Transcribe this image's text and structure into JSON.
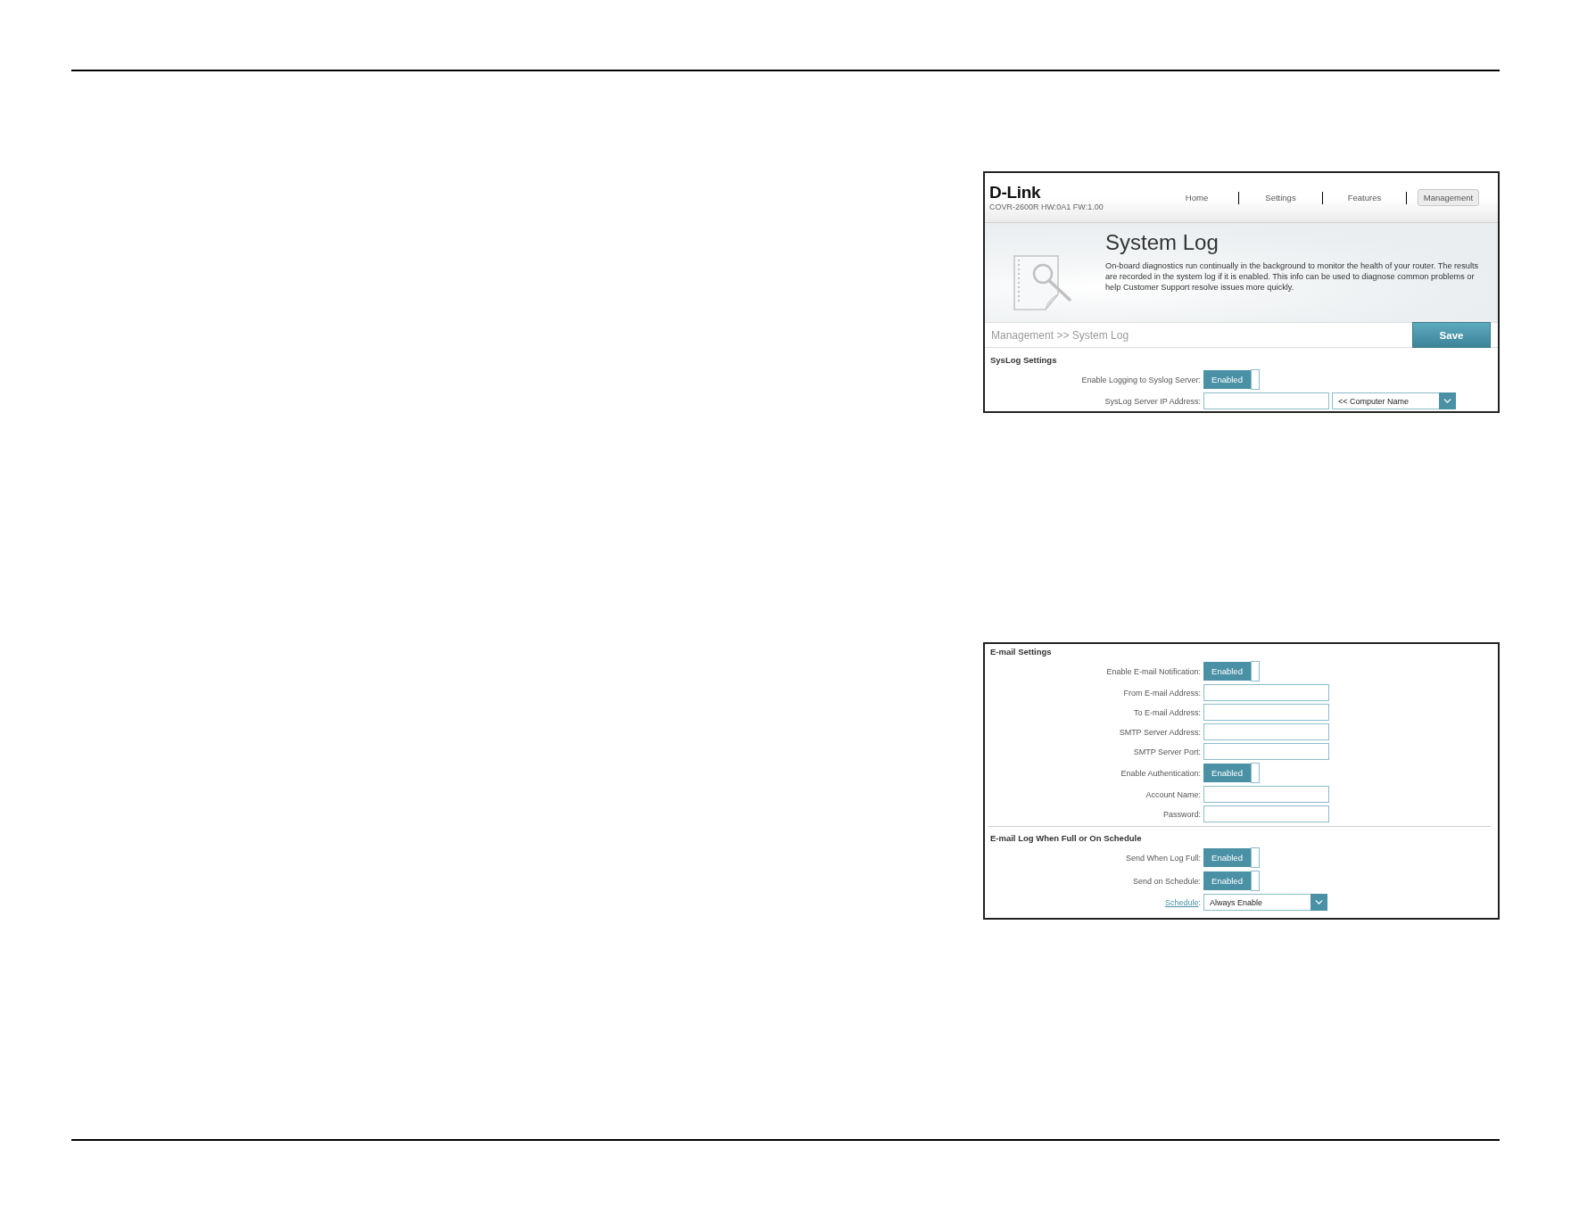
{
  "syslog_screen": {
    "header": {
      "logo": "D-Link",
      "model": "COVR-2600R HW:0A1 FW:1.00",
      "nav": [
        {
          "label": "Home",
          "selected": false
        },
        {
          "label": "Settings",
          "selected": false
        },
        {
          "label": "Features",
          "selected": false
        },
        {
          "label": "Management",
          "selected": true
        }
      ]
    },
    "banner": {
      "title": "System Log",
      "description": "On-board diagnostics run continually in the background to monitor the health of your router. The results are recorded in the system log if it is enabled. This info can be used to diagnose common problems or help Customer Support resolve issues more quickly."
    },
    "breadcrumb": "Management >> System Log",
    "save_button": "Save",
    "sections": [
      {
        "title": "SysLog Settings",
        "rows": [
          {
            "kind": "toggle",
            "label": "Enable Logging to Syslog Server:",
            "on": true,
            "text": "Enabled"
          },
          {
            "kind": "input_select",
            "label": "SysLog Server IP Address:",
            "select": "<< Computer Name"
          }
        ]
      }
    ]
  },
  "email_screen": {
    "sections": [
      {
        "title": "E-mail Settings",
        "rows": [
          {
            "kind": "toggle",
            "label": "Enable E-mail Notification:",
            "on": true,
            "text": "Enabled"
          },
          {
            "kind": "input",
            "label": "From E-mail Address:"
          },
          {
            "kind": "input",
            "label": "To E-mail Address:"
          },
          {
            "kind": "input",
            "label": "SMTP Server Address:"
          },
          {
            "kind": "input",
            "label": "SMTP Server Port:"
          },
          {
            "kind": "toggle",
            "label": "Enable Authentication:",
            "on": true,
            "text": "Enabled"
          },
          {
            "kind": "input",
            "label": "Account Name:"
          },
          {
            "kind": "input",
            "label": "Password:"
          }
        ]
      },
      {
        "title": "E-mail Log When Full or On Schedule",
        "rows": [
          {
            "kind": "toggle",
            "label": "Send When Log Full:",
            "on": true,
            "text": "Enabled"
          },
          {
            "kind": "toggle",
            "label": "Send on Schedule:",
            "on": true,
            "text": "Enabled"
          },
          {
            "kind": "select",
            "label_link": "Schedule",
            "label": ":",
            "select": "Always Enable"
          }
        ]
      }
    ]
  }
}
